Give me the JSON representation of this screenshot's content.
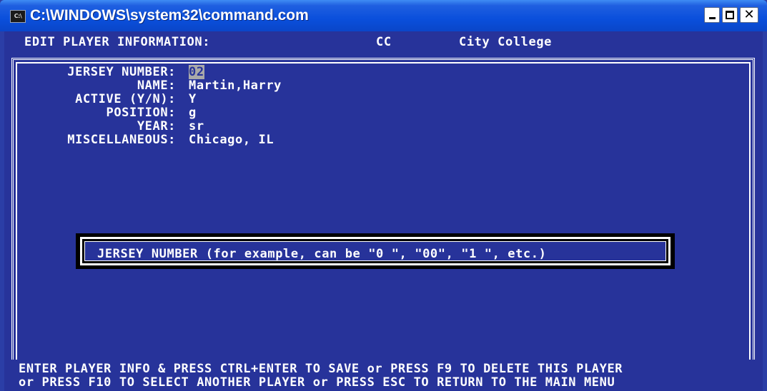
{
  "window": {
    "title": "C:\\WINDOWS\\system32\\command.com",
    "icon": "ms-dos-icon",
    "icon_text": "C:\\"
  },
  "header": {
    "label": "EDIT PLAYER INFORMATION:",
    "team_code": "CC",
    "team_name": "City College"
  },
  "form": {
    "fields": [
      {
        "label": "JERSEY NUMBER:",
        "value": "02"
      },
      {
        "label": "NAME:",
        "value": "Martin,Harry"
      },
      {
        "label": "ACTIVE (Y/N):",
        "value": "Y"
      },
      {
        "label": "POSITION:",
        "value": "g"
      },
      {
        "label": "YEAR:",
        "value": "sr"
      },
      {
        "label": "MISCELLANEOUS:",
        "value": "Chicago, IL"
      }
    ]
  },
  "help_popup": {
    "text": "JERSEY NUMBER (for example, can be \"0 \", \"00\", \"1 \", etc.)"
  },
  "footer": {
    "line1": "ENTER PLAYER INFO & PRESS CTRL+ENTER TO SAVE or PRESS F9 TO DELETE THIS PLAYER",
    "line2": "or PRESS F10 TO SELECT ANOTHER PLAYER or PRESS ESC TO RETURN TO THE MAIN MENU"
  },
  "colors": {
    "console_bg": "#27339a",
    "text": "#ffffff",
    "titlebar": "#0a4fdc"
  }
}
